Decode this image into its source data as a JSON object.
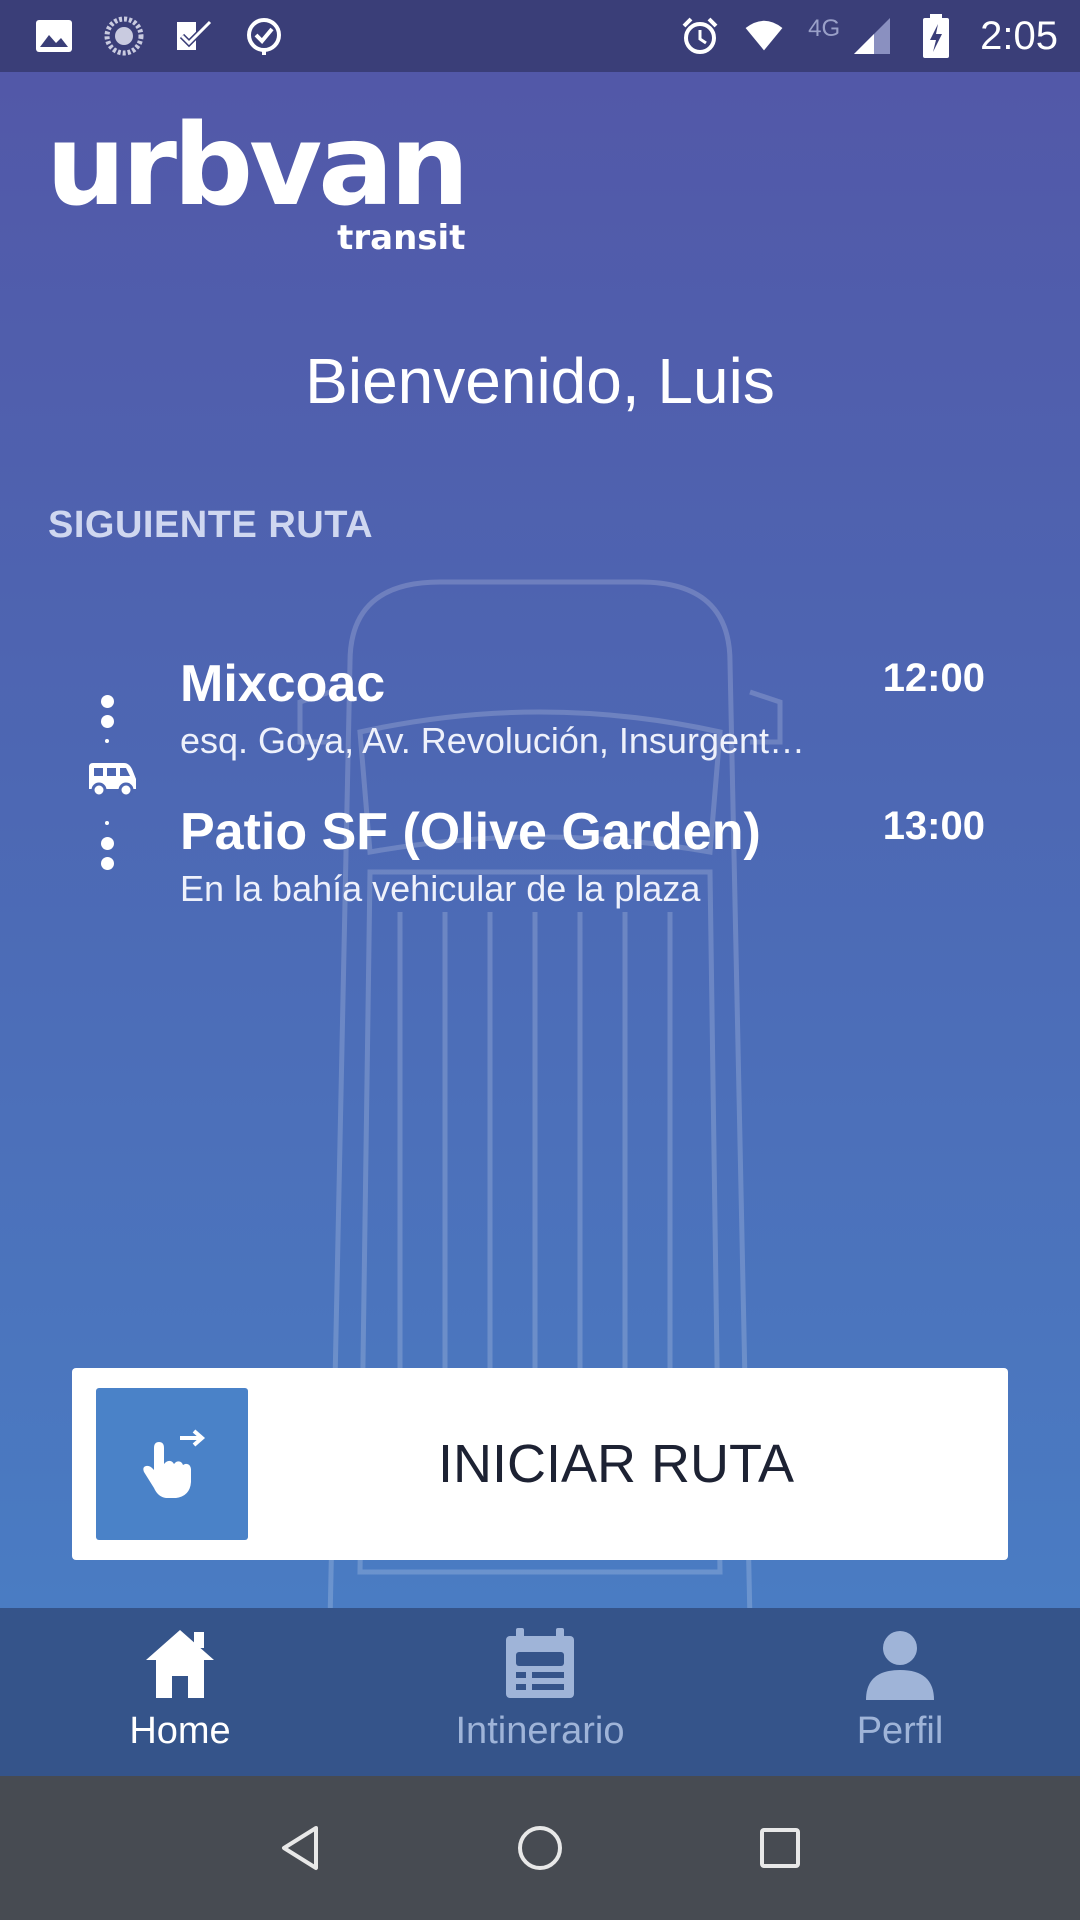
{
  "status_bar": {
    "time": "2:05",
    "network": "4G",
    "icons": [
      "image-icon",
      "sync-icon",
      "check-task-icon",
      "clock-check-icon",
      "alarm-icon",
      "wifi-icon",
      "signal-icon",
      "battery-icon"
    ]
  },
  "logo": {
    "brand": "urbvan",
    "sub": "transit"
  },
  "welcome": "Bienvenido, Luis",
  "section_title": "SIGUIENTE RUTA",
  "route": {
    "origin": {
      "name": "Mixcoac",
      "address": "esq. Goya, Av. Revolución, Insurgent…",
      "time": "12:00"
    },
    "destination": {
      "name": "Patio SF (Olive Garden)",
      "address": "En la bahía vehicular de la plaza",
      "time": "13:00"
    }
  },
  "start_button": {
    "label": "INICIAR RUTA",
    "icon": "swipe-hand-icon"
  },
  "tabs": [
    {
      "label": "Home",
      "icon": "home-icon",
      "active": true
    },
    {
      "label": "Intinerario",
      "icon": "itinerary-icon",
      "active": false
    },
    {
      "label": "Perfil",
      "icon": "profile-icon",
      "active": false
    }
  ],
  "colors": {
    "gradient_top": "#5258a8",
    "gradient_bottom": "#4a7cc3",
    "tab_bar": "#35548a",
    "status_bar": "#3a3e78",
    "nav_bar": "#474b52",
    "accent": "#4a82c8"
  }
}
